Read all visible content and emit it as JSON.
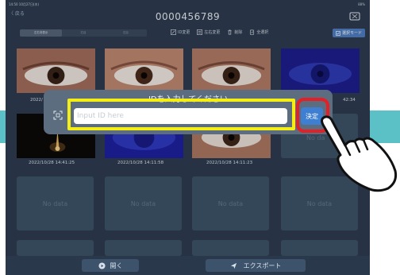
{
  "status": {
    "time": "14:50  10月27日(木)",
    "battery": "88%"
  },
  "header": {
    "back_label": "〈 戻る",
    "patient_id": "0000456789",
    "camera_icon": "camera-switch-icon"
  },
  "toolbar": {
    "segments": [
      {
        "label": "左右非表示"
      },
      {
        "label": "右目"
      },
      {
        "label": "左目"
      }
    ],
    "tools": [
      {
        "label": "ID変更",
        "icon": "edit-icon"
      },
      {
        "label": "左右変更",
        "icon": "swap-icon"
      },
      {
        "label": "削除",
        "icon": "trash-icon"
      },
      {
        "label": "全選択",
        "icon": "select-all-icon"
      }
    ],
    "select_mode_label": "選択モード"
  },
  "grid": {
    "row1_timestamps": [
      "2022/",
      "42:34"
    ],
    "row2_timestamps": [
      "2022/10/28 14:41:25",
      "2022/10/28 14:11:58",
      "2022/10/28 14:11:23"
    ],
    "row2_nodata": "No da",
    "row3": [
      "No data",
      "No data",
      "No data",
      "No data"
    ]
  },
  "dialog": {
    "title": "IDを入力してください",
    "input_placeholder": "Input ID here",
    "input_value": "",
    "confirm_label": "決定"
  },
  "bottom": {
    "open_label": "開く",
    "export_label": "エクスポート"
  },
  "colors": {
    "background": "#2e3d51",
    "accent_teal": "#5cc1c6",
    "highlight_yellow": "#f4ee15",
    "highlight_red": "#e41f26",
    "confirm_blue": "#3f7fd1",
    "select_mode_blue": "#4f7fc4"
  }
}
